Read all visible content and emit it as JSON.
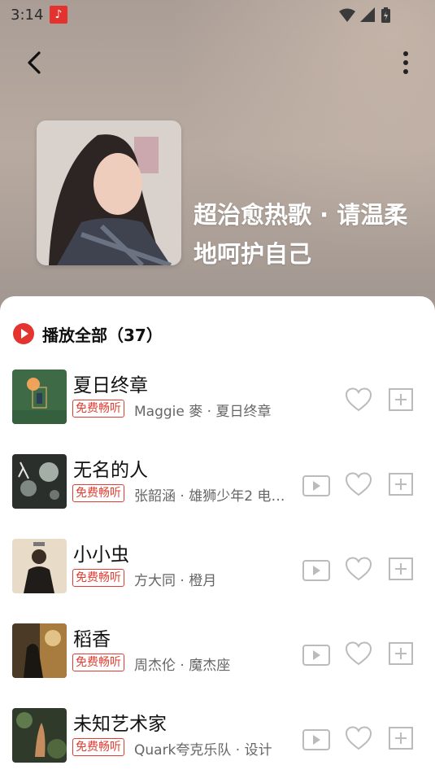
{
  "status_bar": {
    "time": "3:14",
    "badge": "♪"
  },
  "playlist": {
    "title": "超治愈热歌 · 请温柔地呵护自己"
  },
  "play_all": {
    "label": "播放全部（37）"
  },
  "songs": [
    {
      "title": "夏日终章",
      "badge": "免费畅听",
      "sub": "Maggie 麥 · 夏日终章",
      "has_mv": false
    },
    {
      "title": "无名的人",
      "badge": "免费畅听",
      "sub": "张韶涵 · 雄狮少年2 电影…",
      "has_mv": true
    },
    {
      "title": "小小虫",
      "badge": "免费畅听",
      "sub": "方大同 · 橙月",
      "has_mv": true
    },
    {
      "title": "稻香",
      "badge": "免费畅听",
      "sub": "周杰伦 · 魔杰座",
      "has_mv": true
    },
    {
      "title": "未知艺术家",
      "badge": "免费畅听",
      "sub": "Quark夸克乐队 · 设计",
      "has_mv": true
    }
  ],
  "colors": {
    "accent": "#e03c31",
    "header_bg": "#b8aaa0"
  }
}
